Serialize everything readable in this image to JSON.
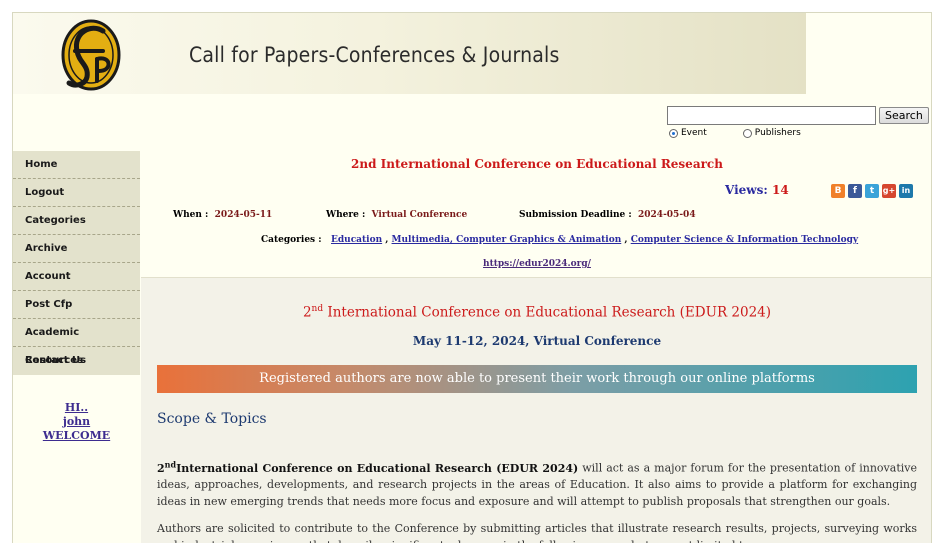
{
  "header": {
    "logo_text": "cfp",
    "banner_title": "Call for Papers-Conferences & Journals"
  },
  "search": {
    "value": "",
    "placeholder": "",
    "button_label": "Search",
    "radio_event": "Event",
    "radio_publishers": "Publishers",
    "selected": "Event"
  },
  "sidebar": {
    "items": [
      {
        "label": "Home"
      },
      {
        "label": "Logout"
      },
      {
        "label": "Categories"
      },
      {
        "label": "Archive"
      },
      {
        "label": "Account"
      },
      {
        "label": "Post Cfp"
      },
      {
        "label": "Academic Resources"
      },
      {
        "label": "Contact Us"
      }
    ],
    "welcome": [
      "HI..",
      "john",
      "WELCOME"
    ]
  },
  "event": {
    "title": "2nd International Conference on Educational Research",
    "views_label": "Views:",
    "views_count": "14",
    "when_label": "When :",
    "when_value": "2024-05-11",
    "where_label": "Where :",
    "where_value": "Virtual Conference",
    "deadline_label": "Submission Deadline :",
    "deadline_value": "2024-05-04",
    "categories_label": "Categories :",
    "categories": [
      "Education",
      "Multimedia, Computer Graphics & Animation",
      "Computer Science & Information Technology"
    ],
    "url": "https://edur2024.org/",
    "share_icons": [
      "blogger-icon",
      "facebook-icon",
      "twitter-icon",
      "google-plus-icon",
      "linkedin-icon"
    ],
    "share_colors": [
      "#f0802a",
      "#3b5998",
      "#3aa3d8",
      "#d6472f",
      "#1e79ab"
    ]
  },
  "body": {
    "title_prefix": "2",
    "title_sup": "nd",
    "title_rest": " International Conference on Educational Research (EDUR 2024)",
    "date_line": "May 11-12, 2024, Virtual Conference",
    "announcement": "Registered authors are now able to present their work through our online platforms",
    "scope_heading": "Scope & Topics",
    "para1_prefix": "2",
    "para1_sup": "nd",
    "para1_bold": "International Conference on Educational Research (EDUR 2024)",
    "para1_rest": " will act as a major forum for the presentation of innovative ideas, approaches, developments, and research projects in the areas of Education. It also aims to provide a platform for exchanging ideas in new emerging trends that needs more focus and exposure and will attempt to publish proposals that strengthen our goals.",
    "para2": "Authors are solicited to contribute to the Conference by submitting articles that illustrate research results, projects, surveying works and industrial experiences that describe significant advances in the following areas, but are not limited to."
  }
}
